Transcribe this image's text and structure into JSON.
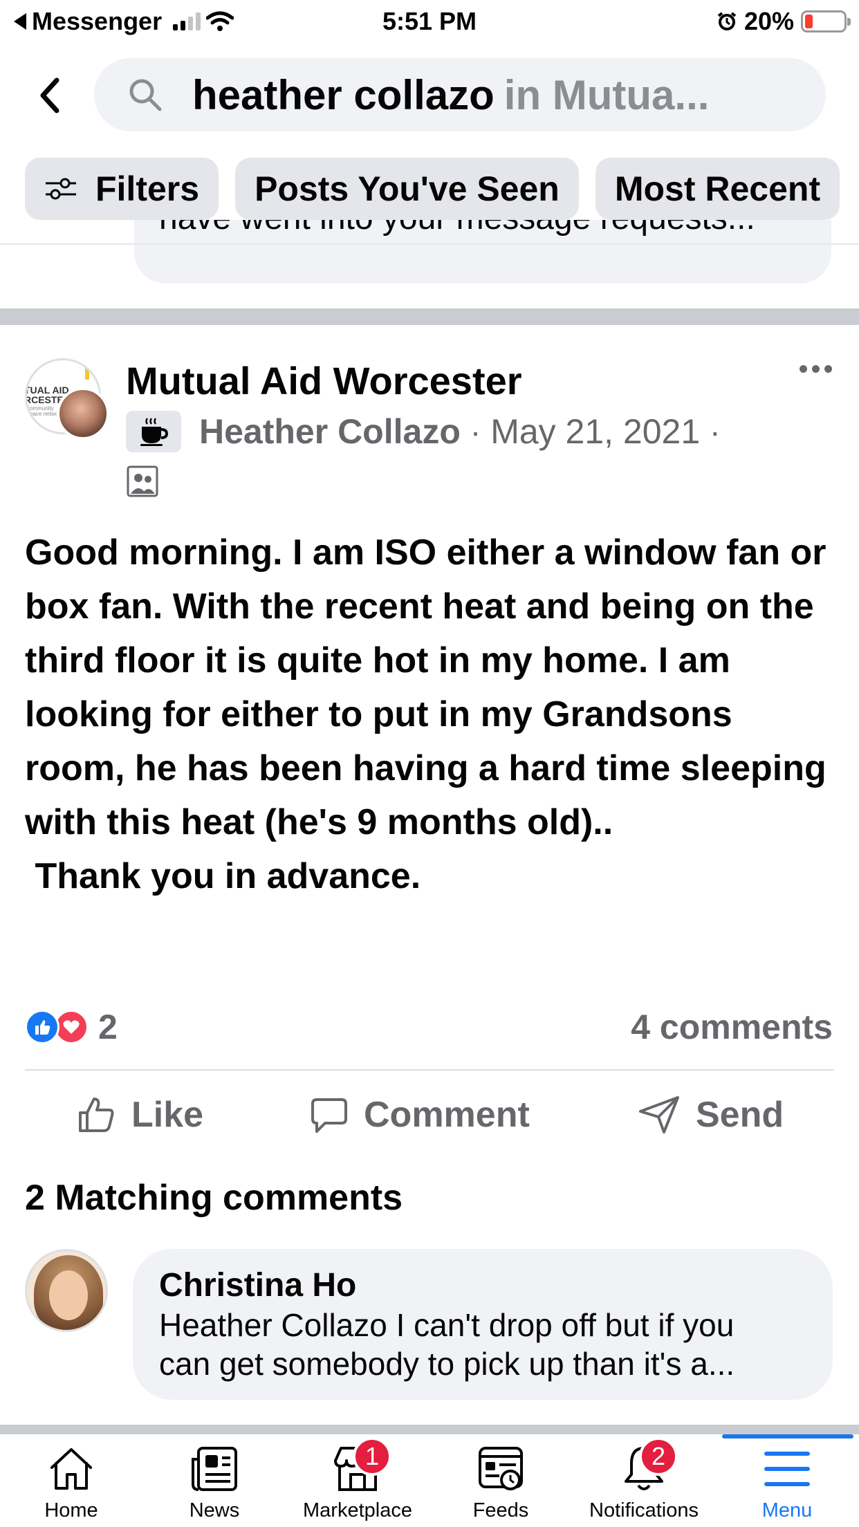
{
  "status_bar": {
    "back_app": "Messenger",
    "time": "5:51 PM",
    "battery": "20%",
    "battery_level": 0.2,
    "signal_bars": 2
  },
  "search": {
    "query": "heather collazo",
    "scope": "in Mutua..."
  },
  "filters": {
    "filters_label": "Filters",
    "posts_seen_label": "Posts You've Seen",
    "most_recent_label": "Most Recent"
  },
  "previous_result": {
    "snippet": "have went into your message requests..."
  },
  "post": {
    "group_name": "Mutual Aid Worcester",
    "group_avatar_text": "TUAL AID\nRCESTE",
    "group_avatar_subtext": "community\nspace network",
    "author": "Heather Collazo",
    "separator": "·",
    "date": "May 21, 2021",
    "body": "Good morning. I am ISO either a window fan or box fan. With the recent heat and being on the third floor it is quite hot in my home. I am looking for either to put in my Grandsons room, he has been having a hard time sleeping with this heat (he's 9 months old)..\n Thank you in advance.",
    "reaction_count": "2",
    "comment_count": "4 comments",
    "actions": {
      "like": "Like",
      "comment": "Comment",
      "send": "Send"
    }
  },
  "matching": {
    "title": "2 Matching comments",
    "comments": [
      {
        "author": "Christina Ho",
        "text": "Heather Collazo I can't drop off but if you\ncan get somebody to pick up than it's a..."
      }
    ]
  },
  "bottom_nav": {
    "items": [
      {
        "label": "Home",
        "icon": "home-icon"
      },
      {
        "label": "News",
        "icon": "news-icon"
      },
      {
        "label": "Marketplace",
        "icon": "marketplace-icon",
        "badge": "1"
      },
      {
        "label": "Feeds",
        "icon": "feeds-icon"
      },
      {
        "label": "Notifications",
        "icon": "bell-icon",
        "badge": "2"
      },
      {
        "label": "Menu",
        "icon": "menu-icon",
        "active": true
      }
    ]
  },
  "colors": {
    "accent": "#1877f2",
    "badge": "#e41e3f",
    "secondary_text": "#65676b",
    "bubble_bg": "#f0f2f5"
  }
}
